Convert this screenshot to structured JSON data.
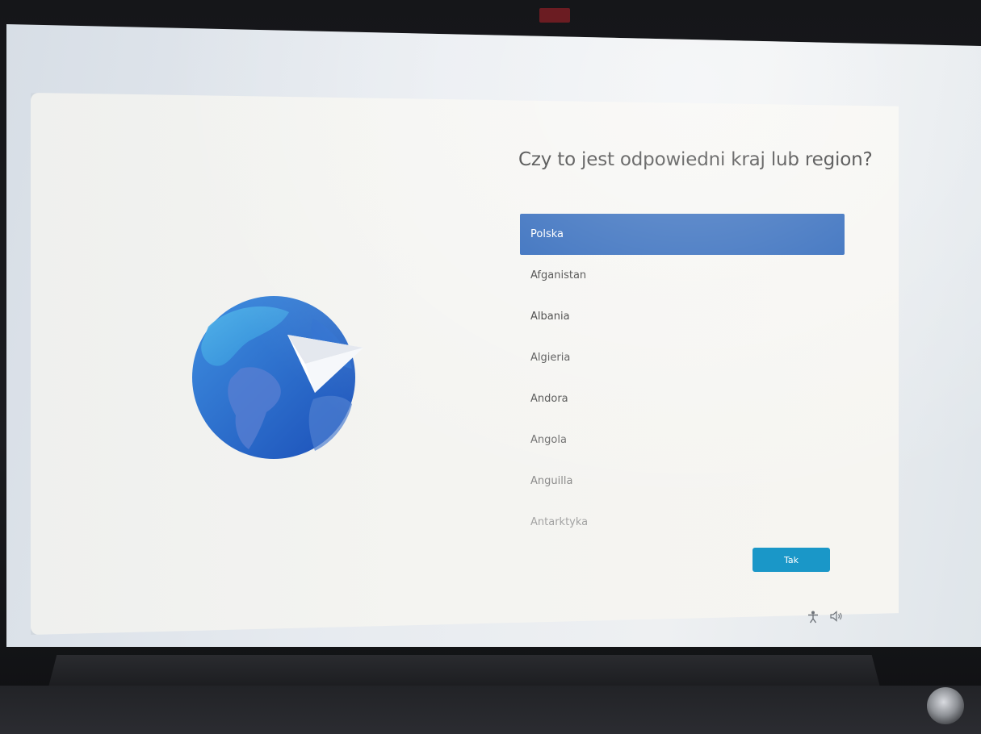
{
  "page": {
    "title": "Czy to jest odpowiedni kraj lub region?"
  },
  "countries": [
    {
      "label": "Polska",
      "selected": true
    },
    {
      "label": "Afganistan",
      "selected": false
    },
    {
      "label": "Albania",
      "selected": false
    },
    {
      "label": "Algieria",
      "selected": false
    },
    {
      "label": "Andora",
      "selected": false
    },
    {
      "label": "Angola",
      "selected": false
    },
    {
      "label": "Anguilla",
      "selected": false
    },
    {
      "label": "Antarktyka",
      "selected": false
    }
  ],
  "actions": {
    "confirm_label": "Tak"
  },
  "icons": {
    "illustration": "globe-paper-plane-icon",
    "accessibility": "accessibility-icon",
    "volume": "volume-icon"
  },
  "colors": {
    "accent": "#1354b2",
    "button": "#1a97c8",
    "globe_dark": "#1d5fc4",
    "globe_light": "#3f94e0"
  }
}
